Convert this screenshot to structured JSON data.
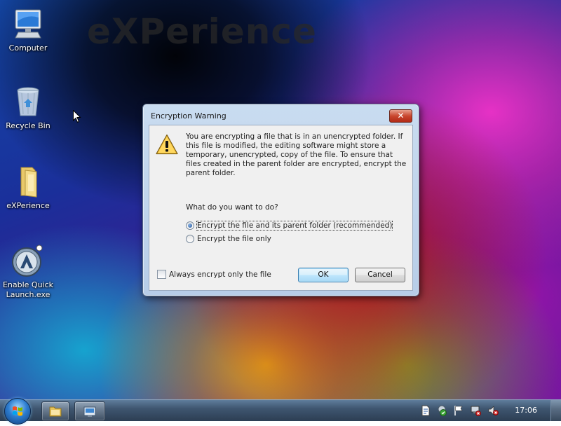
{
  "desktop": {
    "watermark_text": "eXPerience",
    "icons": [
      {
        "label": "Computer",
        "icon": "computer-icon"
      },
      {
        "label": "Recycle Bin",
        "icon": "recycle-bin-icon"
      },
      {
        "label": "eXPerience",
        "icon": "folder-icon"
      },
      {
        "label_line1": "Enable Quick",
        "label_line2": "Launch.exe",
        "icon": "quick-launch-app-icon"
      }
    ]
  },
  "dialog": {
    "title": "Encryption Warning",
    "close_glyph": "✕",
    "message": "You are encrypting a file that is in an unencrypted folder. If this file is modified, the editing software might store a temporary, unencrypted, copy of the file. To ensure that files created in the parent folder are encrypted, encrypt the parent folder.",
    "question": "What do you want to do?",
    "options": [
      {
        "label": "Encrypt the file and its parent folder (recommended)",
        "selected": true
      },
      {
        "label": "Encrypt the file only",
        "selected": false
      }
    ],
    "checkbox": {
      "label": "Always encrypt only the file",
      "checked": false
    },
    "ok_label": "OK",
    "cancel_label": "Cancel"
  },
  "taskbar": {
    "clock": "17:06",
    "items": [
      "windows-explorer-icon",
      "control-panel-icon"
    ],
    "tray": [
      "document-icon",
      "security-icon",
      "action-center-flag-icon",
      "network-disconnected-icon",
      "volume-muted-icon"
    ]
  },
  "colors": {
    "dialog_frame": "#b7cde8",
    "dialog_body": "#f0f0f0",
    "default_button": "#bee6fd",
    "close_button": "#c9472f",
    "taskbar": "#3f5670"
  }
}
